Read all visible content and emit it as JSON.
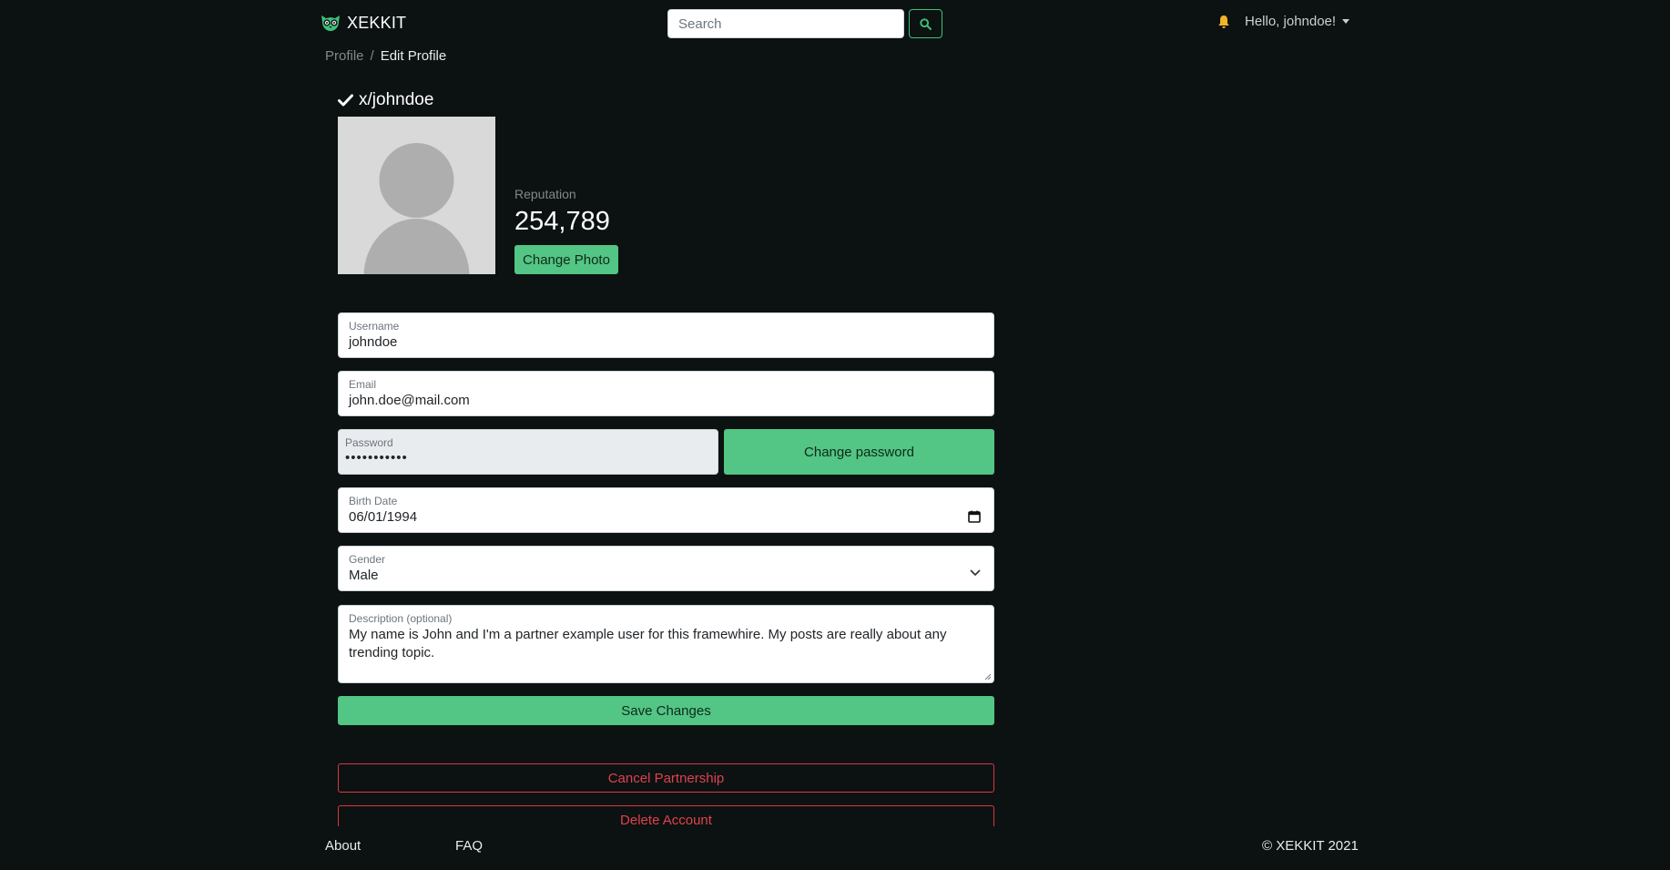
{
  "navbar": {
    "brand": "XEKKIT",
    "search": {
      "placeholder": "Search",
      "value": ""
    },
    "greeting": "Hello, johndoe!"
  },
  "breadcrumb": {
    "parent": "Profile",
    "separator": "/",
    "current": "Edit Profile"
  },
  "profile": {
    "handle": "x/johndoe",
    "reputation_label": "Reputation",
    "reputation_value": "254,789",
    "change_photo_label": "Change Photo"
  },
  "form": {
    "username": {
      "label": "Username",
      "value": "johndoe"
    },
    "email": {
      "label": "Email",
      "value": "john.doe@mail.com"
    },
    "password": {
      "label": "Password",
      "value": "•••••••••••"
    },
    "change_password_label": "Change password",
    "birth_date": {
      "label": "Birth Date",
      "value": "06/01/1994"
    },
    "gender": {
      "label": "Gender",
      "value": "Male"
    },
    "description": {
      "label": "Description (optional)",
      "value": "My name is John and I'm a partner example user for this framewhire. My posts are really about any trending topic."
    },
    "save_label": "Save Changes",
    "cancel_partnership_label": "Cancel Partnership",
    "delete_account_label": "Delete Account"
  },
  "footer": {
    "about": "About",
    "faq": "FAQ",
    "copyright": "© XEKKIT 2021"
  },
  "colors": {
    "background": "#0b1211",
    "accent": "#53c584",
    "danger": "#dc3545",
    "bell": "#f0b429"
  },
  "icons": [
    "owl-logo-icon",
    "search-icon",
    "bell-icon",
    "caret-down-icon",
    "checkmark-icon",
    "avatar-placeholder-icon",
    "calendar-icon",
    "chevron-down-icon",
    "resize-handle-icon"
  ]
}
